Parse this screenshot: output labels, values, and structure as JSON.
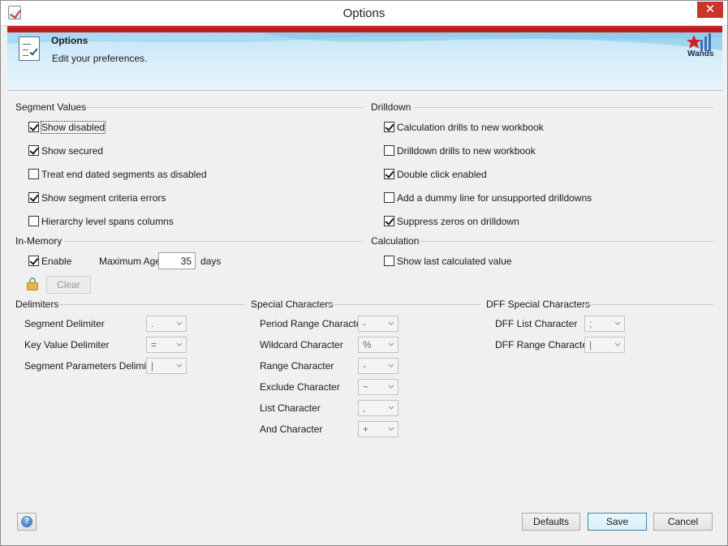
{
  "window": {
    "title": "Options",
    "close_glyph": "✕"
  },
  "banner": {
    "title": "Options",
    "subtitle": "Edit your preferences.",
    "logo_text": "Wands"
  },
  "segment_values": {
    "title": "Segment Values",
    "items": [
      {
        "label": "Show disabled",
        "checked": true
      },
      {
        "label": "Show secured",
        "checked": true
      },
      {
        "label": "Treat end dated segments as disabled",
        "checked": false
      },
      {
        "label": "Show segment criteria errors",
        "checked": true
      },
      {
        "label": "Hierarchy level spans columns",
        "checked": false
      }
    ]
  },
  "drilldown": {
    "title": "Drilldown",
    "items": [
      {
        "label": "Calculation drills to new workbook",
        "checked": true
      },
      {
        "label": "Drilldown drills to new workbook",
        "checked": false
      },
      {
        "label": "Double click enabled",
        "checked": true
      },
      {
        "label": "Add a dummy line for unsupported drilldowns",
        "checked": false
      },
      {
        "label": "Suppress zeros on drilldown",
        "checked": true
      }
    ]
  },
  "in_memory": {
    "title": "In-Memory",
    "enable_label": "Enable",
    "enable_checked": true,
    "max_age_label": "Maximum Age",
    "max_age_value": "35",
    "days_label": "days",
    "clear_label": "Clear"
  },
  "calculation": {
    "title": "Calculation",
    "show_last_label": "Show last calculated value",
    "show_last_checked": false
  },
  "delimiters": {
    "title": "Delimiters",
    "rows": [
      {
        "label": "Segment Delimiter",
        "value": "."
      },
      {
        "label": "Key Value Delimiter",
        "value": "="
      },
      {
        "label": "Segment Parameters Delimiter",
        "value": "|"
      }
    ]
  },
  "special_characters": {
    "title": "Special Characters",
    "rows": [
      {
        "label": "Period Range Character",
        "value": "-"
      },
      {
        "label": "Wildcard Character",
        "value": "%"
      },
      {
        "label": "Range Character",
        "value": "-"
      },
      {
        "label": "Exclude Character",
        "value": "~"
      },
      {
        "label": "List Character",
        "value": ","
      },
      {
        "label": "And Character",
        "value": "+"
      }
    ]
  },
  "dff_special_characters": {
    "title": "DFF Special Characters",
    "rows": [
      {
        "label": "DFF List Character",
        "value": ";"
      },
      {
        "label": "DFF Range Character",
        "value": "|"
      }
    ]
  },
  "footer": {
    "help_glyph": "?",
    "defaults_label": "Defaults",
    "save_label": "Save",
    "cancel_label": "Cancel"
  }
}
